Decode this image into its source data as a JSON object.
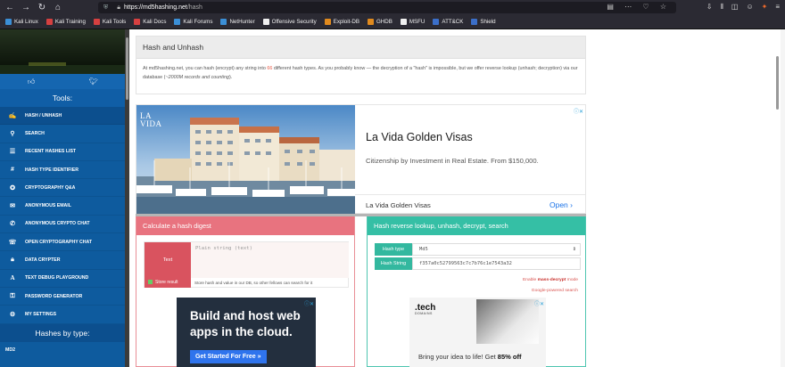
{
  "browser": {
    "url_host": "https://md5hashing.net",
    "url_path": "/hash",
    "bookmarks": [
      {
        "label": "Kali Linux",
        "color": "#3b8fd6"
      },
      {
        "label": "Kali Training",
        "color": "#d64040"
      },
      {
        "label": "Kali Tools",
        "color": "#d64040"
      },
      {
        "label": "Kali Docs",
        "color": "#d64040"
      },
      {
        "label": "Kali Forums",
        "color": "#3b8fd6"
      },
      {
        "label": "NetHunter",
        "color": "#3b8fd6"
      },
      {
        "label": "Offensive Security",
        "color": "#f0f0f0"
      },
      {
        "label": "Exploit-DB",
        "color": "#e08a1e"
      },
      {
        "label": "GHDB",
        "color": "#e08a1e"
      },
      {
        "label": "MSFU",
        "color": "#f0f0f0"
      },
      {
        "label": "ATT&CK",
        "color": "#3b6fc9"
      },
      {
        "label": "Shield",
        "color": "#3b6fc9"
      }
    ]
  },
  "sidebar": {
    "tools_title": "Tools:",
    "items": [
      {
        "label": "HASH / UNHASH",
        "icon": "✍",
        "icon_name": "pen-icon"
      },
      {
        "label": "SEARCH",
        "icon": "⚲",
        "icon_name": "search-icon"
      },
      {
        "label": "RECENT HASHES LIST",
        "icon": "☰",
        "icon_name": "list-icon"
      },
      {
        "label": "HASH TYPE IDENTIFIER",
        "icon": "#",
        "icon_name": "hash-icon"
      },
      {
        "label": "CRYPTOGRAPHY Q&A",
        "icon": "✪",
        "icon_name": "qa-icon"
      },
      {
        "label": "ANONYMOUS EMAIL",
        "icon": "✉",
        "icon_name": "email-icon"
      },
      {
        "label": "ANONYMOUS CRYPTO CHAT",
        "icon": "✆",
        "icon_name": "chat-icon"
      },
      {
        "label": "OPEN CRYPTOGRAPHY CHAT",
        "icon": "☏",
        "icon_name": "open-chat-icon"
      },
      {
        "label": "DATA CRYPTER",
        "icon": "🔒︎",
        "icon_name": "lock-icon"
      },
      {
        "label": "TEXT DEBUG PLAYGROUND",
        "icon": "A",
        "icon_name": "text-icon"
      },
      {
        "label": "PASSWORD GENERATOR",
        "icon": "⚿",
        "icon_name": "key-icon"
      },
      {
        "label": "MY SETTINGS",
        "icon": "⚙",
        "icon_name": "gear-icon"
      }
    ],
    "hashes_title": "Hashes by type:",
    "first_type": "MD2"
  },
  "intro": {
    "title": "Hash and Unhash",
    "text_a": "At md5hashing.net, you can hash (encrypt) any string into ",
    "count": "66",
    "text_b": " different hash types. As you probably know — the decryption of a \"hash\" is impossible, but we offer reverse lookup (unhash; decryption) via our database (",
    "records": "~2000M records and counting",
    "text_c": ")."
  },
  "ad_top": {
    "logo_line1": "LA",
    "logo_line2": "VIDA",
    "title": "La Vida Golden Visas",
    "subtitle": "Citizenship by Investment in Real Estate. From $150,000.",
    "name": "La Vida Golden Visas",
    "cta": "Open",
    "cta_icon": "›"
  },
  "calc": {
    "header": "Calculate a hash digest",
    "text_button": "Text",
    "placeholder": "Plain string (text)",
    "store_label": "Store result",
    "store_note": "Store hash and value in our DB, so other fellows can search for it"
  },
  "lookup": {
    "header": "Hash reverse lookup, unhash, decrypt, search",
    "type_label": "Hash type",
    "type_value": "Md5",
    "string_label": "Hash String",
    "string_value": "f357a0c52799563c7c7b76c1e7543a32",
    "mass_prefix": "Enable ",
    "mass_bold": "mass-decrypt",
    "mass_suffix": " mode",
    "google_link": "Google-powered search"
  },
  "ad_left": {
    "headline": "Build and host web apps in the cloud.",
    "cta": "Get Started For Free »"
  },
  "ad_right": {
    "logo": ".tech",
    "logo_small": "DOMAINS",
    "tag_a": "Bring your idea to life! Get ",
    "tag_b": "85% off"
  }
}
